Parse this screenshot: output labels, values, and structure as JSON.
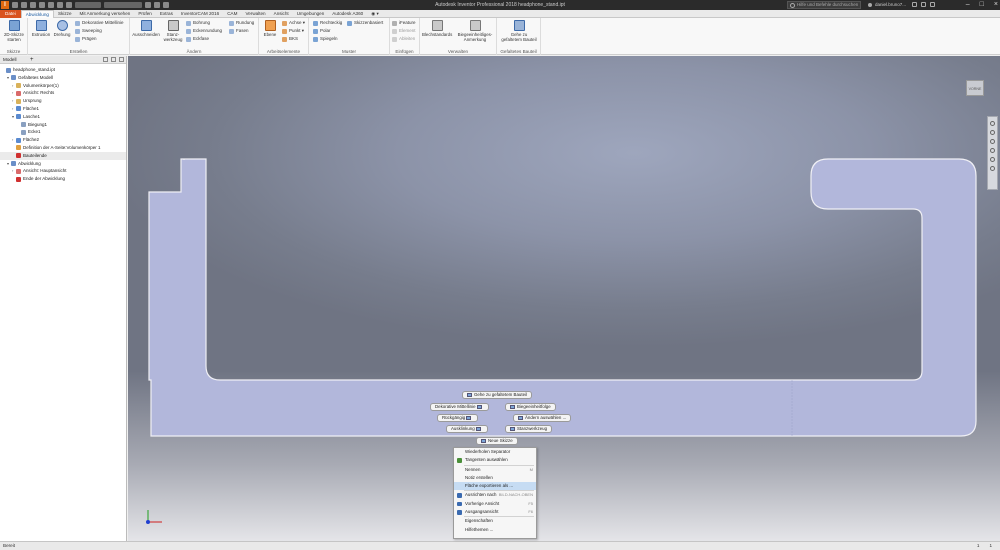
{
  "titlebar": {
    "logo": "I",
    "title": "Autodesk Inventor Professional 2018   headphone_stand.ipt",
    "search_placeholder": "Hilfe und Befehle durchsuchen ...",
    "user": "daniel.bruno7...",
    "controls": [
      "–",
      "□",
      "×"
    ]
  },
  "tabs": [
    "Datei",
    "Abwicklung",
    "Skizze",
    "Mit Anmerkung versehen",
    "Prüfen",
    "Extras",
    "InventorCAM 2016",
    "CAM",
    "Verwalten",
    "Ansicht",
    "Umgebungen",
    "Autodesk A360",
    "◉ ▾"
  ],
  "ribbon": {
    "skizze": {
      "big": [
        "2D-Skizze",
        "starten"
      ],
      "label": "Skizze"
    },
    "erstellen": {
      "extrusion": "Extrusion",
      "drehung": "Drehung",
      "items": [
        "Dekorative Mittellinie",
        "Sweeping",
        "Prägen"
      ],
      "label": "Erstellen"
    },
    "aendern": {
      "ausschneiden": "Ausschneiden",
      "stanz": [
        "Stanz-",
        "werkzeug"
      ],
      "col1": [
        "Bohrung",
        "Eckenrundung",
        "Eckfase"
      ],
      "col2": [
        "Rundung",
        "Fasen"
      ],
      "label": "Ändern"
    },
    "arbeitselemente": {
      "ebene": "Ebene",
      "items": [
        "Achse ▾",
        "Punkt ▾",
        "BKS"
      ],
      "label": "Arbeitselemente"
    },
    "muster": {
      "items": [
        "Rechteckig",
        "Polar",
        "Spiegeln"
      ],
      "skizzenbasiert": "Skizzenbasiert",
      "label": "Muster"
    },
    "einfuegen": {
      "items": [
        "iFeature",
        "Element",
        "Ableiten"
      ],
      "label": "Einfügen"
    },
    "verwalten": {
      "blech": "Blechstandards",
      "biege": [
        "Biegeeinheitliges-",
        "Anmerkung"
      ],
      "label": "Verwalten"
    },
    "gefaltet": {
      "btn": [
        "Gehe zu",
        "gefaltetem Bauteil"
      ],
      "label": "Gefaltetes Bauteil"
    }
  },
  "browser": {
    "tab": "Modell",
    "nodes": [
      {
        "text": "headphone_stand.ipt",
        "indent": 0,
        "exp": "",
        "color": "#6a8fc8"
      },
      {
        "text": "Gefaltetes Modell",
        "indent": 1,
        "exp": "▾",
        "color": "#6a8fc8"
      },
      {
        "text": "Volumenkörper(1)",
        "indent": 2,
        "exp": "›",
        "color": "#d9b25a"
      },
      {
        "text": "Ansicht: Rechts",
        "indent": 2,
        "exp": "›",
        "color": "#d96a6a"
      },
      {
        "text": "Ursprung",
        "indent": 2,
        "exp": "›",
        "color": "#d9b25a"
      },
      {
        "text": "Fläche1",
        "indent": 2,
        "exp": "›",
        "color": "#5a8ad0"
      },
      {
        "text": "Lasche1",
        "indent": 2,
        "exp": "▾",
        "color": "#5a8ad0"
      },
      {
        "text": "Biegung1",
        "indent": 3,
        "exp": "",
        "color": "#8aa0c0"
      },
      {
        "text": "Ecke1",
        "indent": 3,
        "exp": "",
        "color": "#8aa0c0"
      },
      {
        "text": "Fläche2",
        "indent": 2,
        "exp": "›",
        "color": "#5a8ad0"
      },
      {
        "text": "Definition der A-Seite:Volumenkörper 1",
        "indent": 2,
        "exp": "",
        "color": "#e0a040"
      },
      {
        "text": "Bauteilende",
        "indent": 2,
        "exp": "",
        "color": "#d03030",
        "hl": true
      },
      {
        "text": "Abwicklung",
        "indent": 1,
        "exp": "▾",
        "color": "#6a8fc8"
      },
      {
        "text": "Ansicht: Hauptansicht",
        "indent": 2,
        "exp": "›",
        "color": "#d96a6a"
      },
      {
        "text": "Ende der Abwicklung",
        "indent": 2,
        "exp": "",
        "color": "#d03030"
      }
    ]
  },
  "viewcube": {
    "label": "VORNE"
  },
  "marking_menu": {
    "gehe_zu": "Gehe zu gefaltetem Bauteil",
    "deko": "Dekorative Mittellinie",
    "biege": "Biegeeinheitfolge",
    "rueckgaengig": "Rückgängig",
    "aendern": "Ändern auswählen ...",
    "ausklinkung": "Ausklinkung",
    "stanz": "Stanzwerkzeug",
    "neue_skizze": "Neue Skizze"
  },
  "context_menu": [
    {
      "label": "Wiederholen Separator",
      "shortcut": "",
      "icon": ""
    },
    {
      "label": "Tangenten auswählen",
      "shortcut": "",
      "icon": "#4a8f3a"
    },
    {
      "sep": true
    },
    {
      "label": "Nennen",
      "shortcut": "M",
      "icon": ""
    },
    {
      "label": "Notiz erstellen",
      "shortcut": "",
      "icon": ""
    },
    {
      "label": "Fläche exportieren als ...",
      "shortcut": "",
      "icon": "",
      "sel": true
    },
    {
      "sep": true
    },
    {
      "label": "Ausrichten nach",
      "shortcut": "BILD-NACH-OBEN",
      "icon": "#3a6ab0"
    },
    {
      "label": "Vorherige Ansicht",
      "shortcut": "F5",
      "icon": "#3a6ab0"
    },
    {
      "label": "Ausgangsansicht",
      "shortcut": "F6",
      "icon": "#3a6ab0"
    },
    {
      "sep": true
    },
    {
      "label": "Eigenschaften",
      "shortcut": "",
      "icon": ""
    },
    {
      "label": "Hilfethemen ...",
      "shortcut": "",
      "icon": ""
    }
  ],
  "statusbar": {
    "text": "Bereit",
    "n1": "1",
    "n2": "1"
  },
  "colors": {
    "part_fill": "#b2b7db",
    "part_stroke": "#f0f0f5",
    "accent": "#d9531e"
  }
}
